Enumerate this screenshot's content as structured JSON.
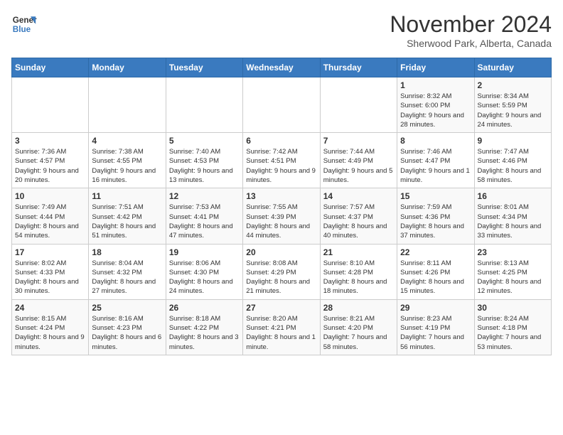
{
  "header": {
    "logo_line1": "General",
    "logo_line2": "Blue",
    "month": "November 2024",
    "location": "Sherwood Park, Alberta, Canada"
  },
  "weekdays": [
    "Sunday",
    "Monday",
    "Tuesday",
    "Wednesday",
    "Thursday",
    "Friday",
    "Saturday"
  ],
  "weeks": [
    [
      {
        "day": "",
        "sunrise": "",
        "sunset": "",
        "daylight": ""
      },
      {
        "day": "",
        "sunrise": "",
        "sunset": "",
        "daylight": ""
      },
      {
        "day": "",
        "sunrise": "",
        "sunset": "",
        "daylight": ""
      },
      {
        "day": "",
        "sunrise": "",
        "sunset": "",
        "daylight": ""
      },
      {
        "day": "",
        "sunrise": "",
        "sunset": "",
        "daylight": ""
      },
      {
        "day": "1",
        "sunrise": "Sunrise: 8:32 AM",
        "sunset": "Sunset: 6:00 PM",
        "daylight": "Daylight: 9 hours and 28 minutes."
      },
      {
        "day": "2",
        "sunrise": "Sunrise: 8:34 AM",
        "sunset": "Sunset: 5:59 PM",
        "daylight": "Daylight: 9 hours and 24 minutes."
      }
    ],
    [
      {
        "day": "3",
        "sunrise": "Sunrise: 7:36 AM",
        "sunset": "Sunset: 4:57 PM",
        "daylight": "Daylight: 9 hours and 20 minutes."
      },
      {
        "day": "4",
        "sunrise": "Sunrise: 7:38 AM",
        "sunset": "Sunset: 4:55 PM",
        "daylight": "Daylight: 9 hours and 16 minutes."
      },
      {
        "day": "5",
        "sunrise": "Sunrise: 7:40 AM",
        "sunset": "Sunset: 4:53 PM",
        "daylight": "Daylight: 9 hours and 13 minutes."
      },
      {
        "day": "6",
        "sunrise": "Sunrise: 7:42 AM",
        "sunset": "Sunset: 4:51 PM",
        "daylight": "Daylight: 9 hours and 9 minutes."
      },
      {
        "day": "7",
        "sunrise": "Sunrise: 7:44 AM",
        "sunset": "Sunset: 4:49 PM",
        "daylight": "Daylight: 9 hours and 5 minutes."
      },
      {
        "day": "8",
        "sunrise": "Sunrise: 7:46 AM",
        "sunset": "Sunset: 4:47 PM",
        "daylight": "Daylight: 9 hours and 1 minute."
      },
      {
        "day": "9",
        "sunrise": "Sunrise: 7:47 AM",
        "sunset": "Sunset: 4:46 PM",
        "daylight": "Daylight: 8 hours and 58 minutes."
      }
    ],
    [
      {
        "day": "10",
        "sunrise": "Sunrise: 7:49 AM",
        "sunset": "Sunset: 4:44 PM",
        "daylight": "Daylight: 8 hours and 54 minutes."
      },
      {
        "day": "11",
        "sunrise": "Sunrise: 7:51 AM",
        "sunset": "Sunset: 4:42 PM",
        "daylight": "Daylight: 8 hours and 51 minutes."
      },
      {
        "day": "12",
        "sunrise": "Sunrise: 7:53 AM",
        "sunset": "Sunset: 4:41 PM",
        "daylight": "Daylight: 8 hours and 47 minutes."
      },
      {
        "day": "13",
        "sunrise": "Sunrise: 7:55 AM",
        "sunset": "Sunset: 4:39 PM",
        "daylight": "Daylight: 8 hours and 44 minutes."
      },
      {
        "day": "14",
        "sunrise": "Sunrise: 7:57 AM",
        "sunset": "Sunset: 4:37 PM",
        "daylight": "Daylight: 8 hours and 40 minutes."
      },
      {
        "day": "15",
        "sunrise": "Sunrise: 7:59 AM",
        "sunset": "Sunset: 4:36 PM",
        "daylight": "Daylight: 8 hours and 37 minutes."
      },
      {
        "day": "16",
        "sunrise": "Sunrise: 8:01 AM",
        "sunset": "Sunset: 4:34 PM",
        "daylight": "Daylight: 8 hours and 33 minutes."
      }
    ],
    [
      {
        "day": "17",
        "sunrise": "Sunrise: 8:02 AM",
        "sunset": "Sunset: 4:33 PM",
        "daylight": "Daylight: 8 hours and 30 minutes."
      },
      {
        "day": "18",
        "sunrise": "Sunrise: 8:04 AM",
        "sunset": "Sunset: 4:32 PM",
        "daylight": "Daylight: 8 hours and 27 minutes."
      },
      {
        "day": "19",
        "sunrise": "Sunrise: 8:06 AM",
        "sunset": "Sunset: 4:30 PM",
        "daylight": "Daylight: 8 hours and 24 minutes."
      },
      {
        "day": "20",
        "sunrise": "Sunrise: 8:08 AM",
        "sunset": "Sunset: 4:29 PM",
        "daylight": "Daylight: 8 hours and 21 minutes."
      },
      {
        "day": "21",
        "sunrise": "Sunrise: 8:10 AM",
        "sunset": "Sunset: 4:28 PM",
        "daylight": "Daylight: 8 hours and 18 minutes."
      },
      {
        "day": "22",
        "sunrise": "Sunrise: 8:11 AM",
        "sunset": "Sunset: 4:26 PM",
        "daylight": "Daylight: 8 hours and 15 minutes."
      },
      {
        "day": "23",
        "sunrise": "Sunrise: 8:13 AM",
        "sunset": "Sunset: 4:25 PM",
        "daylight": "Daylight: 8 hours and 12 minutes."
      }
    ],
    [
      {
        "day": "24",
        "sunrise": "Sunrise: 8:15 AM",
        "sunset": "Sunset: 4:24 PM",
        "daylight": "Daylight: 8 hours and 9 minutes."
      },
      {
        "day": "25",
        "sunrise": "Sunrise: 8:16 AM",
        "sunset": "Sunset: 4:23 PM",
        "daylight": "Daylight: 8 hours and 6 minutes."
      },
      {
        "day": "26",
        "sunrise": "Sunrise: 8:18 AM",
        "sunset": "Sunset: 4:22 PM",
        "daylight": "Daylight: 8 hours and 3 minutes."
      },
      {
        "day": "27",
        "sunrise": "Sunrise: 8:20 AM",
        "sunset": "Sunset: 4:21 PM",
        "daylight": "Daylight: 8 hours and 1 minute."
      },
      {
        "day": "28",
        "sunrise": "Sunrise: 8:21 AM",
        "sunset": "Sunset: 4:20 PM",
        "daylight": "Daylight: 7 hours and 58 minutes."
      },
      {
        "day": "29",
        "sunrise": "Sunrise: 8:23 AM",
        "sunset": "Sunset: 4:19 PM",
        "daylight": "Daylight: 7 hours and 56 minutes."
      },
      {
        "day": "30",
        "sunrise": "Sunrise: 8:24 AM",
        "sunset": "Sunset: 4:18 PM",
        "daylight": "Daylight: 7 hours and 53 minutes."
      }
    ]
  ]
}
